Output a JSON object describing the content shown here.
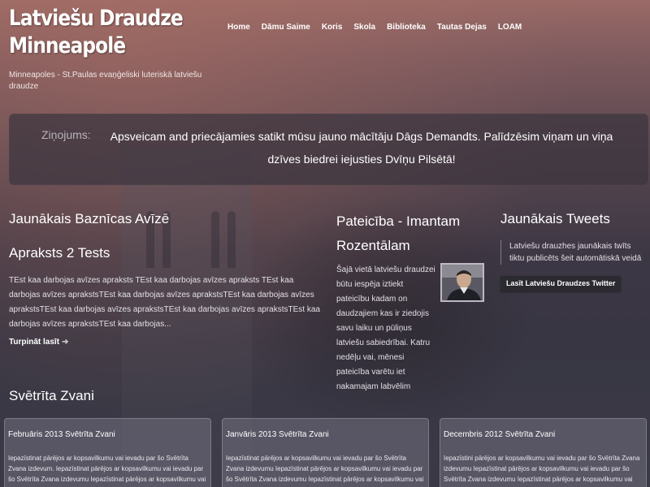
{
  "header": {
    "site_title": "Latviešu Draudze Minneapolē",
    "tagline": "Minneapoles - St.Paulas evaņģeliski luteriskā latviešu draudze"
  },
  "nav": {
    "items": [
      {
        "label": "Home"
      },
      {
        "label": "Dāmu Saime"
      },
      {
        "label": "Koris"
      },
      {
        "label": "Skola"
      },
      {
        "label": "Biblioteka"
      },
      {
        "label": "Tautas Dejas"
      },
      {
        "label": "LOAM"
      }
    ]
  },
  "message": {
    "label": "Ziņojums:",
    "text": "Apsveicam and priecājamies satikt mūsu jauno mācītāju Dāgs Demandts. Palīdzēsim viņam un viņa dzīves biedrei iejusties Dvīņu Pilsētā!"
  },
  "newsletter": {
    "title": "Jaunākais Baznīcas Avīzē",
    "subtitle": "Apraksts 2 Tests",
    "body": "TEst kaa darbojas avīzes apraksts TEst kaa darbojas avīzes apraksts TEst kaa darbojas avīzes aprakstsTEst kaa darbojas avīzes aprakstsTEst kaa darbojas avīzes aprakstsTEst kaa darbojas avīzes aprakstsTEst kaa darbojas avīzes aprakstsTEst kaa darbojas avīzes aprakstsTEst kaa darbojas...",
    "read_more": "Turpināt lasīt"
  },
  "thanks": {
    "title": "Pateicība - Imantam Rozentālam",
    "body": "Šajā vietā latviešu draudzei būtu iespēja iztiekt pateicību kadam on daudzajiem kas ir ziedojis savu laiku un pūliņus latviešu sabiedrībai. Katru nedēļu vai, mēnesi pateicība varētu iet nakamajam labvēlim"
  },
  "tweets": {
    "title": "Jaunākais Tweets",
    "tweet": "Latviešu drauzhes jaunākais twīts tiktu publicēts šeit automātiskā veidā",
    "button": "Lasīt Latviešu Draudzes Twitter"
  },
  "bells": {
    "title": "Svētrīta Zvani",
    "cards": [
      {
        "title": "Februāris 2013 Svētrīta Zvani",
        "body": "Iepazīstinat pārējos ar kopsavilkumu vai ievadu par šo Svētrīta Zvana izdevum. Iepazīstinat pārējos ar kopsavilkumu vai ievadu par šo Svētrīta Zvana izdevumu Iepazīstinat pārējos ar kopsavilkumu vai ievadu par šo"
      },
      {
        "title": "Janvāris 2013 Svētrīta Zvani",
        "body": "Iepazīstinat pārējos ar kopsavilkumu vai ievadu par šo Svētrīta Zvana izdevumu Iepazīstinat pārējos ar kopsavilkumu vai ievadu par šo Svētrīta Zvana izdevumu Iepazīstinat pārējos ar kopsavilkumu vai ievadu par šo"
      },
      {
        "title": "Decembris 2012 Svētrīta Zvani",
        "body": "Iepazīstini pārējos ar kopsavilkumu vai ievadu par šo Svētrīta Zvana izdevumu Iepazīstinat pārējos ar kopsavilkumu vai ievadu par šo Svētrīta Zvana izdevumu Iepazīstinat pārējos ar kopsavilkumu vai ievadu par šo"
      }
    ]
  }
}
